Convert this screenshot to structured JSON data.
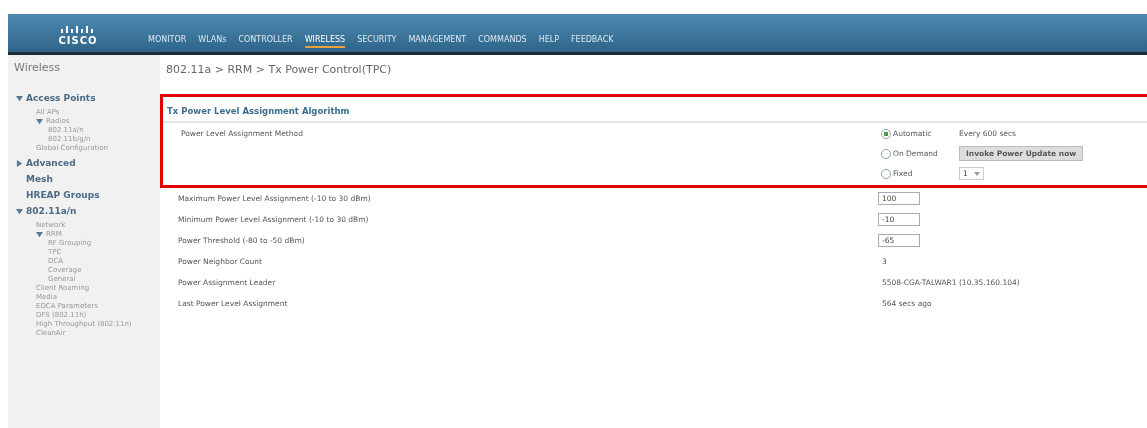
{
  "header": {
    "logo": "CISCO",
    "nav": [
      {
        "label": "MONITOR",
        "selected": false
      },
      {
        "label": "WLANs",
        "selected": false
      },
      {
        "label": "CONTROLLER",
        "selected": false
      },
      {
        "label": "WIRELESS",
        "selected": true
      },
      {
        "label": "SECURITY",
        "selected": false
      },
      {
        "label": "MANAGEMENT",
        "selected": false
      },
      {
        "label": "COMMANDS",
        "selected": false
      },
      {
        "label": "HELP",
        "selected": false
      },
      {
        "label": "FEEDBACK",
        "selected": false
      }
    ]
  },
  "sidebar": {
    "title": "Wireless",
    "items": [
      {
        "label": "Access Points",
        "expanded": true,
        "children": [
          {
            "label": "All APs"
          },
          {
            "label": "Radios",
            "expanded": true,
            "children": [
              {
                "label": "802.11a/n"
              },
              {
                "label": "802.11b/g/n"
              }
            ]
          },
          {
            "label": "Global Configuration"
          }
        ]
      },
      {
        "label": "Advanced",
        "expanded": false
      },
      {
        "label": "Mesh"
      },
      {
        "label": "HREAP Groups"
      },
      {
        "label": "802.11a/n",
        "expanded": true,
        "children": [
          {
            "label": "Network"
          },
          {
            "label": "RRM",
            "expanded": true,
            "children": [
              {
                "label": "RF Grouping"
              },
              {
                "label": "TPC"
              },
              {
                "label": "DCA"
              },
              {
                "label": "Coverage"
              },
              {
                "label": "General"
              }
            ]
          },
          {
            "label": "Client Roaming"
          },
          {
            "label": "Media"
          },
          {
            "label": "EDCA Parameters"
          },
          {
            "label": "DFS (802.11h)"
          },
          {
            "label": "High Throughput (802.11n)"
          },
          {
            "label": "CleanAir"
          }
        ]
      }
    ]
  },
  "breadcrumb": "802.11a > RRM > Tx Power Control(TPC)",
  "section": {
    "title": "Tx Power Level Assignment Algorithm",
    "method_label": "Power Level Assignment Method",
    "methods": [
      {
        "label": "Automatic",
        "selected": true,
        "kind": "text",
        "text": "Every 600 secs"
      },
      {
        "label": "On Demand",
        "selected": false,
        "kind": "button",
        "text": "Invoke Power Update now"
      },
      {
        "label": "Fixed",
        "selected": false,
        "kind": "select",
        "text": "1"
      }
    ]
  },
  "rows": [
    {
      "label": "Maximum Power Level Assignment (-10 to 30 dBm)",
      "kind": "input",
      "value": "100"
    },
    {
      "label": "Minimum Power Level Assignment (-10 to 30 dBm)",
      "kind": "input",
      "value": "-10"
    },
    {
      "label": "Power Threshold (-80 to -50 dBm)",
      "kind": "input",
      "value": "-65"
    },
    {
      "label": "Power Neighbor Count",
      "kind": "text",
      "value": "3"
    },
    {
      "label": "Power Assignment Leader",
      "kind": "text",
      "value": "5508-CGA-TALWAR1 (10.35.160.104)"
    },
    {
      "label": "Last Power Level Assignment",
      "kind": "text",
      "value": "564 secs ago"
    }
  ]
}
